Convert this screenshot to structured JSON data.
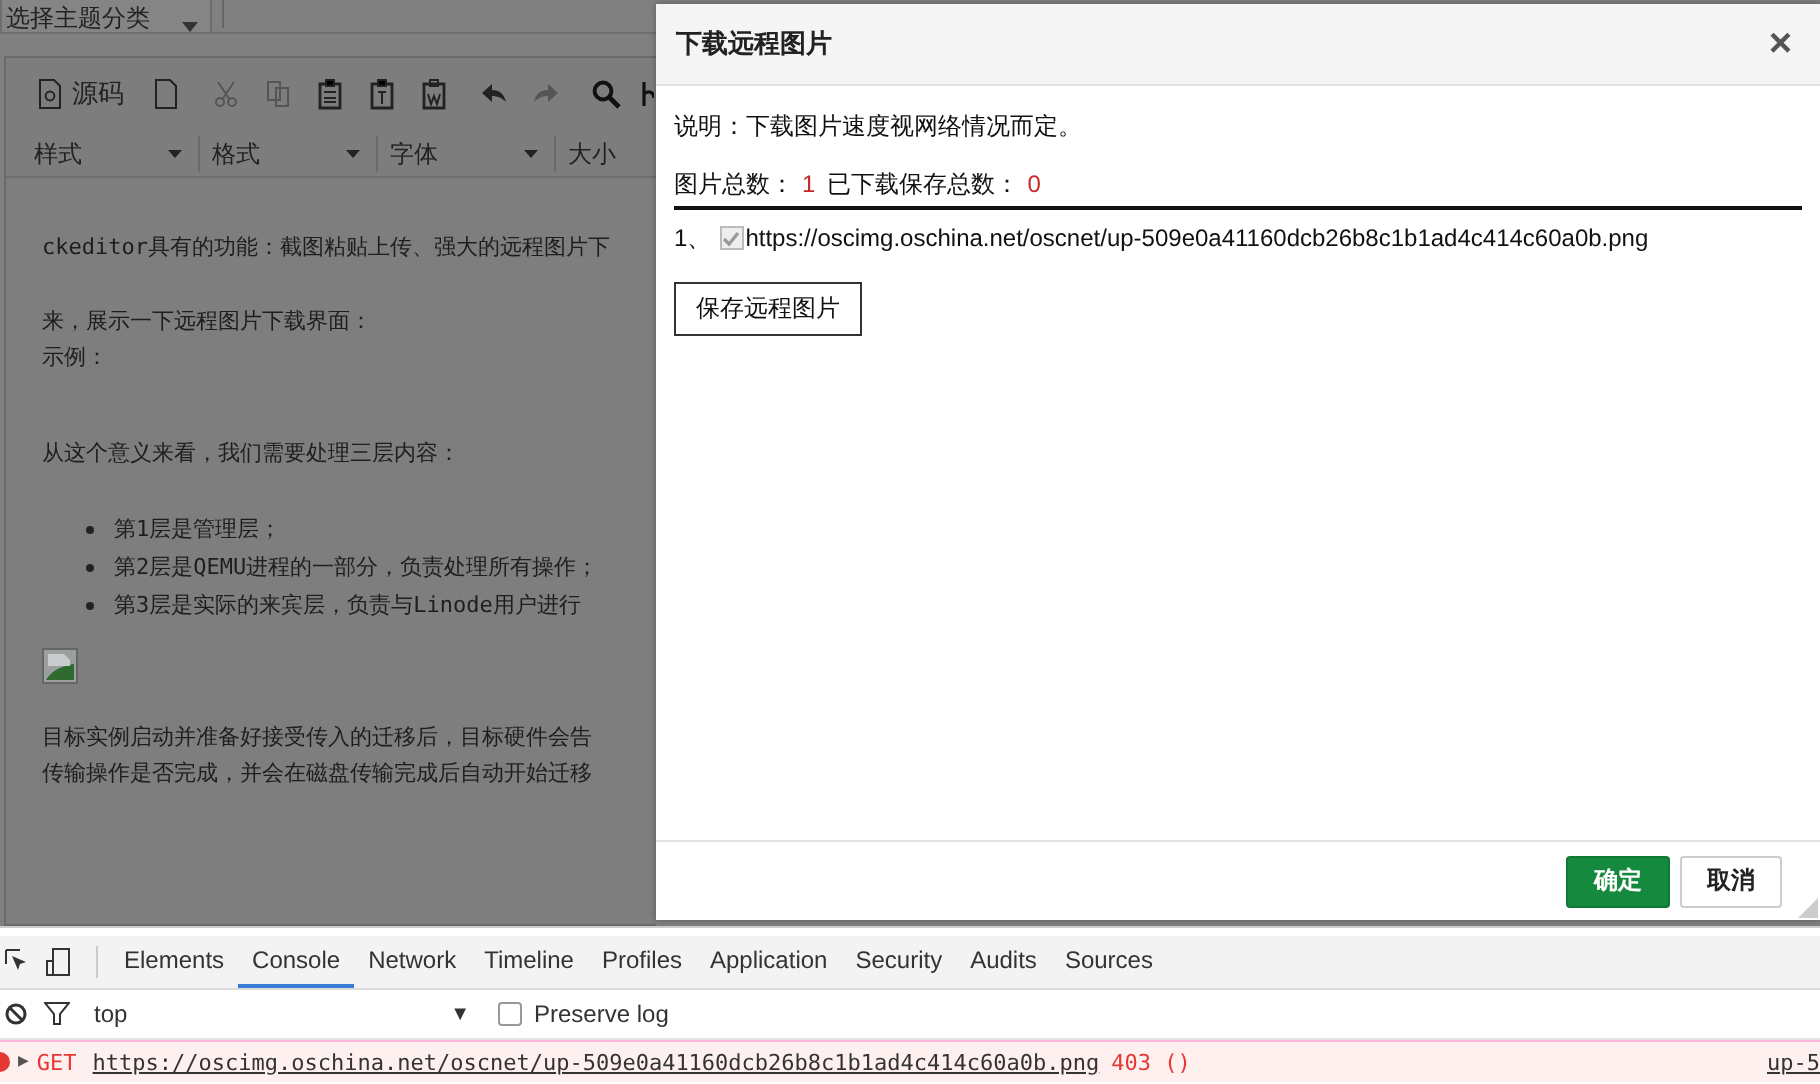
{
  "editor": {
    "topic_select": {
      "value": "选择主题分类"
    },
    "toolbar": {
      "source_label": "源码",
      "dropdowns": [
        "样式",
        "格式",
        "字体",
        "大小"
      ]
    },
    "content": [
      {
        "kind": "paragraph",
        "lines": [
          "ckeditor具有的功能：截图粘贴上传、强大的远程图片下"
        ]
      },
      {
        "kind": "paragraph",
        "lines": [
          "来，展示一下远程图片下载界面：",
          "示例："
        ]
      },
      {
        "kind": "paragraph",
        "lines": [
          "从这个意义来看，我们需要处理三层内容："
        ]
      },
      {
        "kind": "list",
        "items": [
          "第1层是管理层；",
          "第2层是QEMU进程的一部分，负责处理所有操作；",
          "第3层是实际的来宾层，负责与Linode用户进行"
        ]
      },
      {
        "kind": "image"
      },
      {
        "kind": "paragraph",
        "lines": [
          "目标实例启动并准备好接受传入的迁移后，目标硬件会告",
          "传输操作是否完成，并会在磁盘传输完成后自动开始迁移"
        ]
      }
    ]
  },
  "dialog": {
    "title": "下载远程图片",
    "close": "×",
    "note": "说明：下载图片速度视网络情况而定。",
    "total_label": "图片总数：",
    "total": "1",
    "saved_label": "已下载保存总数：",
    "saved": "0",
    "images": [
      {
        "index": "1、",
        "checked": true,
        "disabled": true,
        "url": "https://oscimg.oschina.net/oscnet/up-509e0a41160dcb26b8c1b1ad4c414c60a0b.png"
      }
    ],
    "save_button": "保存远程图片",
    "ok_button": "确定",
    "cancel_button": "取消"
  },
  "devtools": {
    "tabs": [
      {
        "label": "Elements",
        "selected": false
      },
      {
        "label": "Console",
        "selected": true
      },
      {
        "label": "Network",
        "selected": false
      },
      {
        "label": "Timeline",
        "selected": false
      },
      {
        "label": "Profiles",
        "selected": false
      },
      {
        "label": "Application",
        "selected": false
      },
      {
        "label": "Security",
        "selected": false
      },
      {
        "label": "Audits",
        "selected": false
      },
      {
        "label": "Sources",
        "selected": false
      }
    ],
    "context": "top",
    "caret": "▼",
    "preserve_log": {
      "label": "Preserve log",
      "checked": false
    },
    "messages": [
      {
        "kind": "error",
        "expander": "▶",
        "method": "GET",
        "url": "https://oscimg.oschina.net/oscnet/up-509e0a41160dcb26b8c1b1ad4c414c60a0b.png",
        "status": "403 ()",
        "source": "up-5"
      }
    ]
  }
}
